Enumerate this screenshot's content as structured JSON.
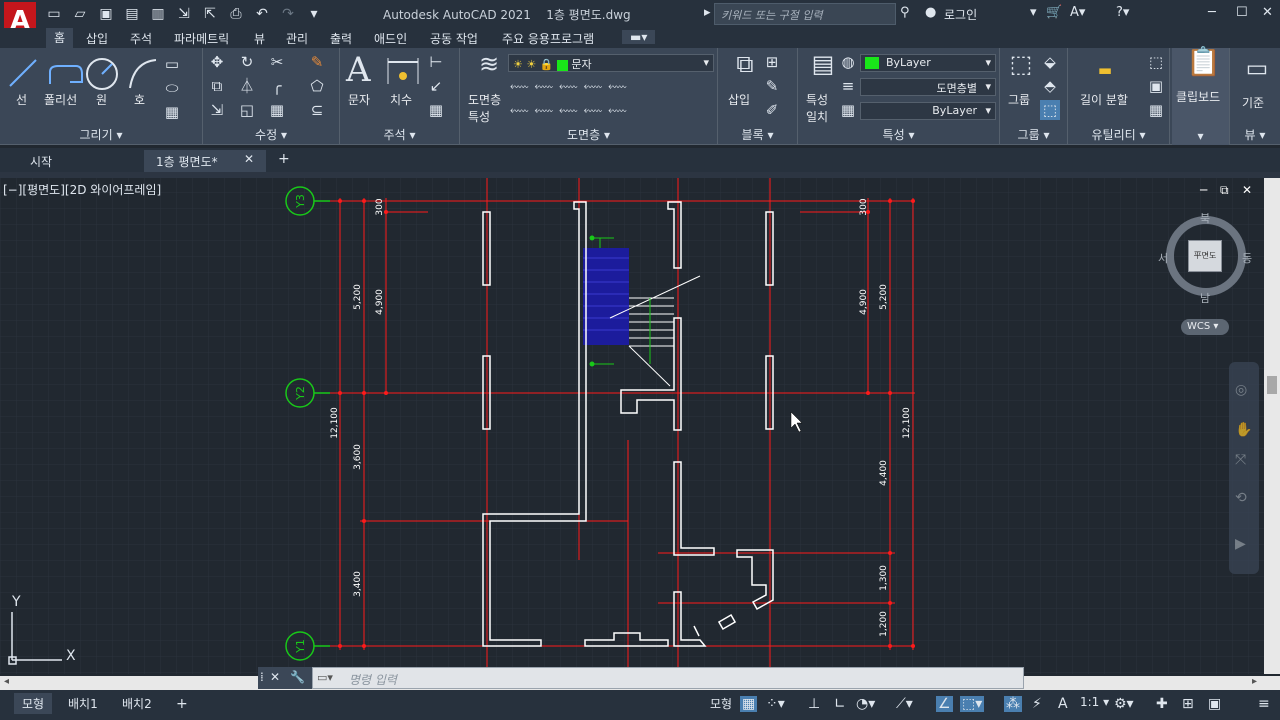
{
  "app": {
    "title": "Autodesk AutoCAD 2021",
    "document": "1층 평면도.dwg",
    "logo": "A"
  },
  "search": {
    "placeholder": "키워드 또는 구절 입력"
  },
  "user": {
    "login": "로그인"
  },
  "ribbon_tabs": [
    "홈",
    "삽입",
    "주석",
    "파라메트릭",
    "뷰",
    "관리",
    "출력",
    "애드인",
    "공동 작업",
    "주요 응용프로그램"
  ],
  "panels": {
    "draw": {
      "title": "그리기",
      "tools": [
        "선",
        "폴리선",
        "원",
        "호"
      ]
    },
    "modify": {
      "title": "수정"
    },
    "annotation": {
      "title": "주석",
      "tools": [
        "문자",
        "치수"
      ]
    },
    "layers": {
      "title": "도면층",
      "tool": "도면층 특성",
      "current": "문자"
    },
    "block": {
      "title": "블록",
      "tool": "삽입"
    },
    "properties": {
      "title": "특성",
      "tool": "특성 일치",
      "color": "ByLayer",
      "linetype": "도면층별",
      "lineweight": "ByLayer"
    },
    "groups": {
      "title": "그룹",
      "tool": "그룹"
    },
    "utilities": {
      "title": "유틸리티",
      "tool": "길이 분할"
    },
    "clipboard": {
      "tool": "클립보드"
    },
    "view": {
      "title": "뷰",
      "tool": "기준"
    }
  },
  "file_tabs": [
    "시작",
    "1층 평면도*"
  ],
  "viewport": {
    "label": "[−][평면도][2D 와이어프레임]"
  },
  "viewcube": {
    "north": "북",
    "south": "남",
    "west": "서",
    "east": "동",
    "face": "平면도",
    "wcs": "WCS"
  },
  "drawing": {
    "grid_labels": [
      "Y3",
      "Y2",
      "Y1"
    ],
    "dims_left": [
      "300",
      "5,200",
      "4,900",
      "12,100",
      "3,600",
      "3,400"
    ],
    "dims_right": [
      "300",
      "4,900",
      "5,200",
      "12,100",
      "4,400",
      "1,300",
      "1,200"
    ]
  },
  "ucs": {
    "x": "X",
    "y": "Y"
  },
  "command": {
    "placeholder": "명령 입력"
  },
  "status": {
    "tabs": [
      "모형",
      "배치1",
      "배치2"
    ],
    "model": "모형",
    "scale": "1:1"
  },
  "colors": {
    "accent": "#ff1a1a",
    "grid_label": "#19c819",
    "hatch": "#1c1c9c"
  }
}
